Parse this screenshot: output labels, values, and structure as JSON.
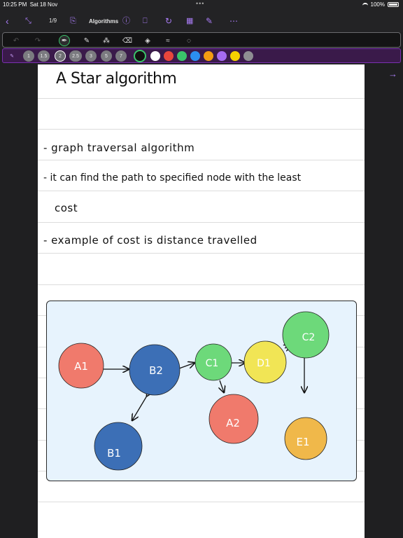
{
  "status": {
    "time": "10:25 PM",
    "date": "Sat 18 Nov",
    "battery": "100%"
  },
  "toolbar": {
    "page_indicator": "1/9",
    "title": "Algorithms"
  },
  "pen_sizes": [
    "1",
    "1.5",
    "2",
    "2.5",
    "3",
    "5",
    "7"
  ],
  "colors": [
    "#111111",
    "#ffffff",
    "#e8463c",
    "#3ac46a",
    "#2b8ef0",
    "#f39c12",
    "#a66bf0",
    "#f5d000",
    "#8e8e93"
  ],
  "note": {
    "title": "A Star algorithm",
    "lines": [
      "- graph traversal algorithm",
      "- it can find the path to specified node with the least",
      "cost",
      "- example of cost is distance travelled"
    ]
  },
  "graph": {
    "nodes": [
      {
        "id": "A1",
        "label": "A1",
        "color": "#f07a6c"
      },
      {
        "id": "B2",
        "label": "B2",
        "color": "#3c6fb6"
      },
      {
        "id": "B1",
        "label": "B1",
        "color": "#3c6fb6"
      },
      {
        "id": "C1",
        "label": "C1",
        "color": "#6dd97a"
      },
      {
        "id": "D1",
        "label": "D1",
        "color": "#f1e555"
      },
      {
        "id": "C2",
        "label": "C2",
        "color": "#6dd97a"
      },
      {
        "id": "A2",
        "label": "A2",
        "color": "#f07a6c"
      },
      {
        "id": "E1",
        "label": "E1",
        "color": "#f0b84a"
      }
    ]
  }
}
